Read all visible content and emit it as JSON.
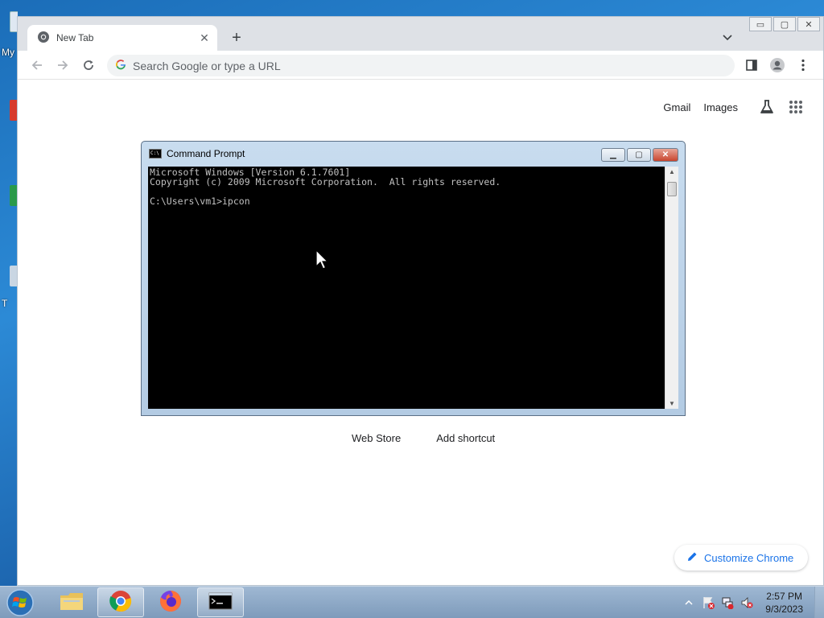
{
  "desktop": {
    "labels": [
      "My",
      "T"
    ]
  },
  "browser": {
    "tab": {
      "title": "New Tab"
    },
    "new_tab_label": "+",
    "omnibox": {
      "placeholder": "Search Google or type a URL"
    },
    "window_controls": {
      "minimize": "▭",
      "restore": "▢",
      "close": "✕"
    },
    "ntp": {
      "gmail": "Gmail",
      "images": "Images",
      "shortcuts": [
        "Web Store",
        "Add shortcut"
      ],
      "customize": "Customize Chrome"
    }
  },
  "cmd": {
    "title": "Command Prompt",
    "icon_text": "C:\\",
    "lines": [
      "Microsoft Windows [Version 6.1.7601]",
      "Copyright (c) 2009 Microsoft Corporation.  All rights reserved.",
      "",
      "C:\\Users\\vm1>ipcon"
    ],
    "buttons": {
      "minimize": "▁",
      "maximize": "▢",
      "close": "✕"
    }
  },
  "taskbar": {
    "apps": [
      "windows-explorer",
      "google-chrome",
      "firefox",
      "command-prompt"
    ],
    "active_app": "command-prompt",
    "clock": {
      "time": "2:57 PM",
      "date": "9/3/2023"
    }
  }
}
